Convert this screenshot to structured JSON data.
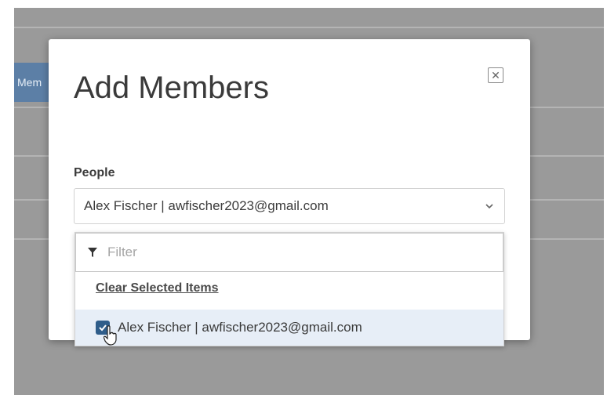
{
  "background": {
    "tab_label": "Mem"
  },
  "modal": {
    "title": "Add Members",
    "close_glyph": "✕",
    "people_label": "People",
    "selected_value": "Alex Fischer | awfischer2023@gmail.com"
  },
  "dropdown": {
    "filter_placeholder": "Filter",
    "clear_label": "Clear Selected Items",
    "options": [
      {
        "label": "Alex Fischer | awfischer2023@gmail.com",
        "checked": true
      }
    ]
  },
  "icons": {
    "close": "close-icon",
    "chevron": "chevron-down-icon",
    "filter": "filter-icon",
    "check": "check-icon",
    "cursor": "hand-cursor-icon"
  },
  "colors": {
    "overlay": "#9a9a9a",
    "checkbox": "#2f5d8a",
    "selected_row": "#e7eef7",
    "tab_bg": "#5c7fa6"
  }
}
